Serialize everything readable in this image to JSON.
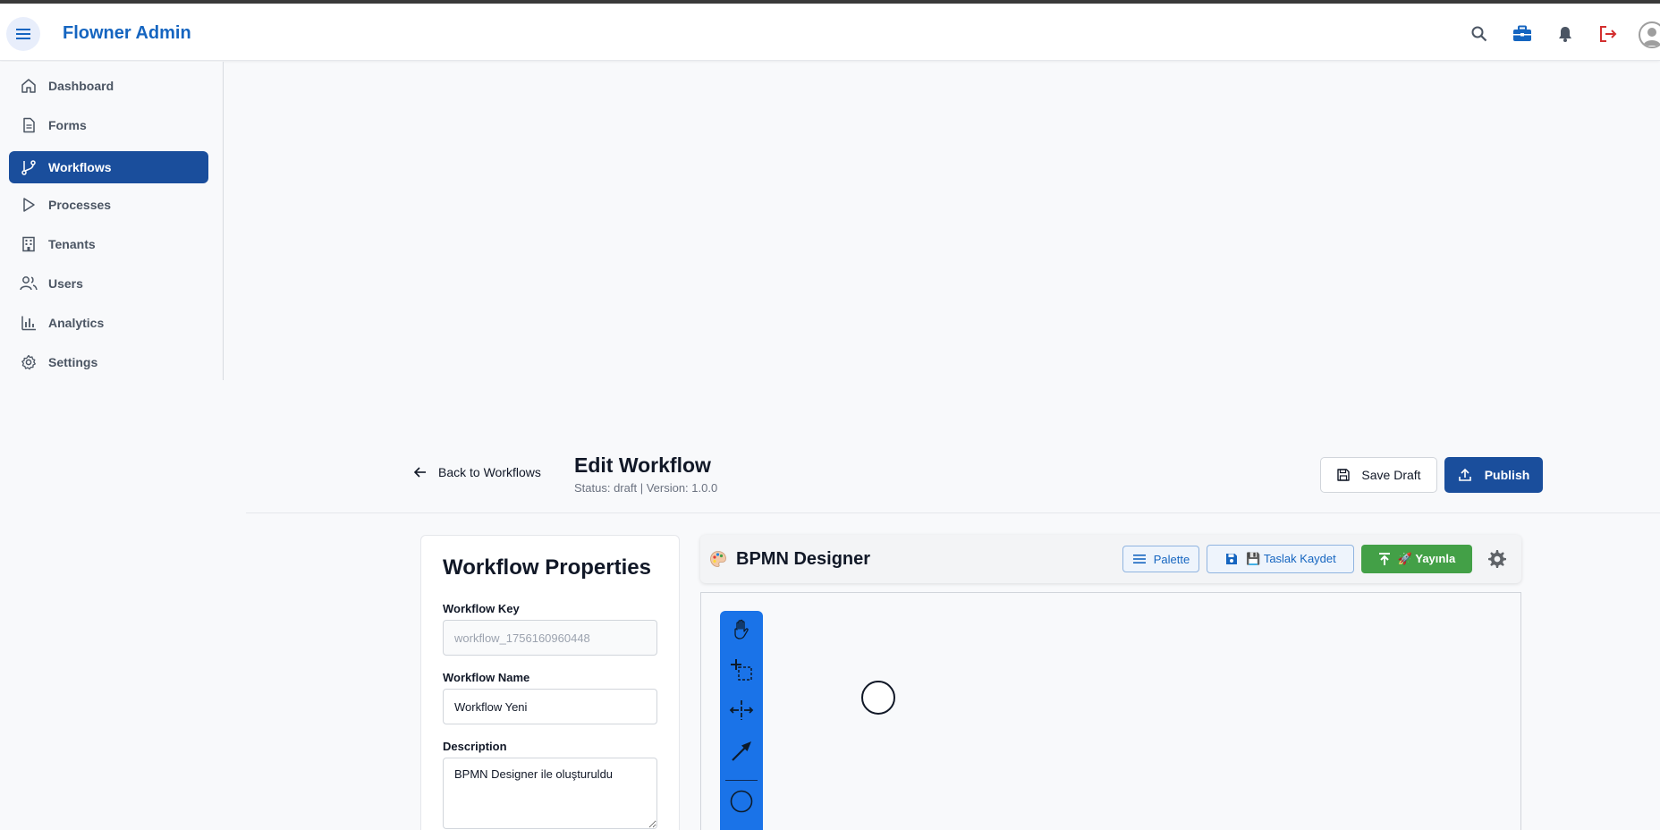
{
  "app": {
    "title": "Flowner Admin"
  },
  "topbar": {
    "icons": [
      "search-icon",
      "briefcase-icon",
      "bell-icon",
      "logout-icon",
      "avatar-icon"
    ],
    "colors": {
      "brand": "#1565c0",
      "logout": "#d32f2f"
    }
  },
  "sidebar": {
    "items": [
      {
        "label": "Dashboard",
        "icon": "home-icon",
        "active": false
      },
      {
        "label": "Forms",
        "icon": "document-icon",
        "active": false
      },
      {
        "label": "Workflows",
        "icon": "git-branch-icon",
        "active": true
      },
      {
        "label": "Processes",
        "icon": "play-icon",
        "active": false
      },
      {
        "label": "Tenants",
        "icon": "building-icon",
        "active": false
      },
      {
        "label": "Users",
        "icon": "users-icon",
        "active": false
      },
      {
        "label": "Analytics",
        "icon": "bar-chart-icon",
        "active": false
      },
      {
        "label": "Settings",
        "icon": "gear-icon",
        "active": false
      }
    ]
  },
  "header": {
    "back_label": "Back to Workflows",
    "title": "Edit Workflow",
    "status": "Status: draft | Version: 1.0.0",
    "save_draft_label": "Save Draft",
    "publish_label": "Publish"
  },
  "properties": {
    "title": "Workflow Properties",
    "key_label": "Workflow Key",
    "key_value": "workflow_1756160960448",
    "name_label": "Workflow Name",
    "name_value": "Workflow Yeni",
    "description_label": "Description",
    "description_value": "BPMN Designer ile oluşturuldu"
  },
  "designer": {
    "title": "BPMN Designer",
    "palette_label": "Palette",
    "taslak_label": "💾 Taslak Kaydet",
    "yayinla_label": "🚀 Yayınla",
    "tools": [
      "hand-tool-icon",
      "lasso-tool-icon",
      "space-tool-icon",
      "connect-tool-icon",
      "start-event-tool-icon"
    ],
    "accent": "#1a73e8",
    "publish_color": "#43a047"
  }
}
